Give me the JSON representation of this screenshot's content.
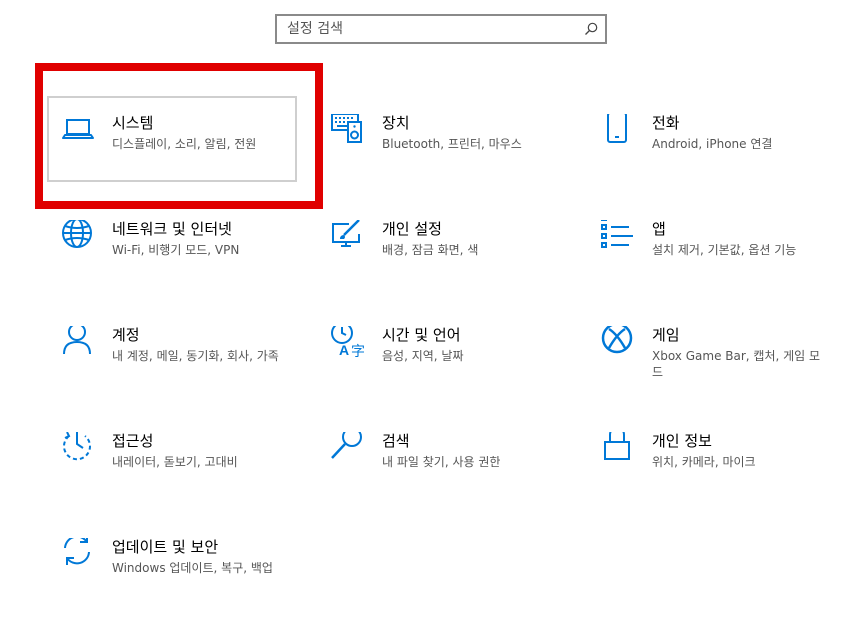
{
  "search": {
    "placeholder": "설정 검색",
    "value": ""
  },
  "tiles": [
    {
      "title": "시스템",
      "desc": "디스플레이, 소리, 알림, 전원",
      "icon": "laptop-icon"
    },
    {
      "title": "장치",
      "desc": "Bluetooth, 프린터, 마우스",
      "icon": "keyboard-speaker-icon"
    },
    {
      "title": "전화",
      "desc": "Android, iPhone 연결",
      "icon": "phone-icon"
    },
    {
      "title": "네트워크 및 인터넷",
      "desc": "Wi-Fi, 비행기 모드, VPN",
      "icon": "globe-icon"
    },
    {
      "title": "개인 설정",
      "desc": "배경, 잠금 화면, 색",
      "icon": "paint-monitor-icon"
    },
    {
      "title": "앱",
      "desc": "설치 제거, 기본값, 옵션 기능",
      "icon": "app-list-icon"
    },
    {
      "title": "계정",
      "desc": "내 계정, 메일, 동기화, 회사, 가족",
      "icon": "person-icon"
    },
    {
      "title": "시간 및 언어",
      "desc": "음성, 지역, 날짜",
      "icon": "time-language-icon"
    },
    {
      "title": "게임",
      "desc": "Xbox Game Bar, 캡처, 게임 모드",
      "icon": "xbox-icon"
    },
    {
      "title": "접근성",
      "desc": "내레이터, 돋보기, 고대비",
      "icon": "ease-of-access-icon"
    },
    {
      "title": "검색",
      "desc": "내 파일 찾기, 사용 권한",
      "icon": "search-magnifier-icon"
    },
    {
      "title": "개인 정보",
      "desc": "위치, 카메라, 마이크",
      "icon": "lock-icon"
    },
    {
      "title": "업데이트 및 보안",
      "desc": "Windows 업데이트, 복구, 백업",
      "icon": "sync-icon"
    }
  ],
  "colors": {
    "accent": "#0078d7",
    "highlight": "#e00000"
  }
}
